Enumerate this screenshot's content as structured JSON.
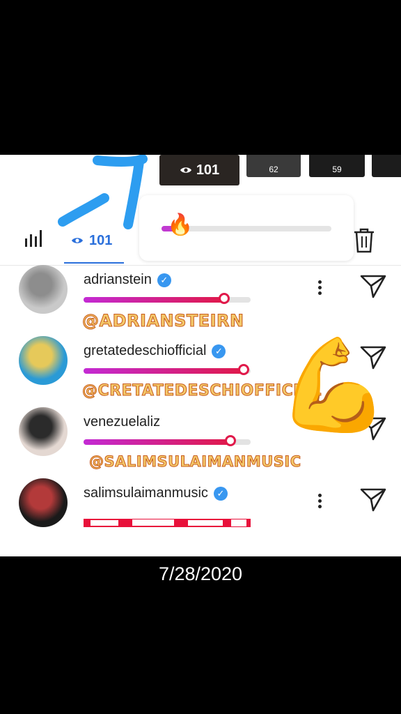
{
  "story_strip": {
    "active_views": "101",
    "tiles": [
      "62",
      "59",
      ""
    ]
  },
  "tabs": {
    "views_count": "101"
  },
  "slider": {
    "level": 0.1,
    "emoji": "🔥"
  },
  "viewers": [
    {
      "username": "adrianstein",
      "verified": true,
      "reaction": 0.84,
      "caption": "@ADRIANSTEIRN"
    },
    {
      "username": "gretatedeschiofficial",
      "verified": true,
      "reaction": 0.96,
      "caption": "@CRETATEDESCHIOFFICIAL"
    },
    {
      "username": "venezuelaliz",
      "verified": false,
      "reaction": 0.88,
      "caption": "@SALIMSULAIMANMUSIC"
    },
    {
      "username": "salimsulaimanmusic",
      "verified": true,
      "reaction": null,
      "caption": ""
    }
  ],
  "sticker": {
    "emoji": "💪"
  },
  "footer": {
    "date": "7/28/2020"
  },
  "icons": [
    "eye-icon",
    "bar-chart-icon",
    "trash-icon",
    "more-icon",
    "send-icon",
    "verified-icon"
  ],
  "colors": {
    "accent_blue": "#2a6fdb",
    "verified": "#3897f0",
    "slider_pink": "#c13ad1",
    "slider_red": "#e0194a"
  }
}
